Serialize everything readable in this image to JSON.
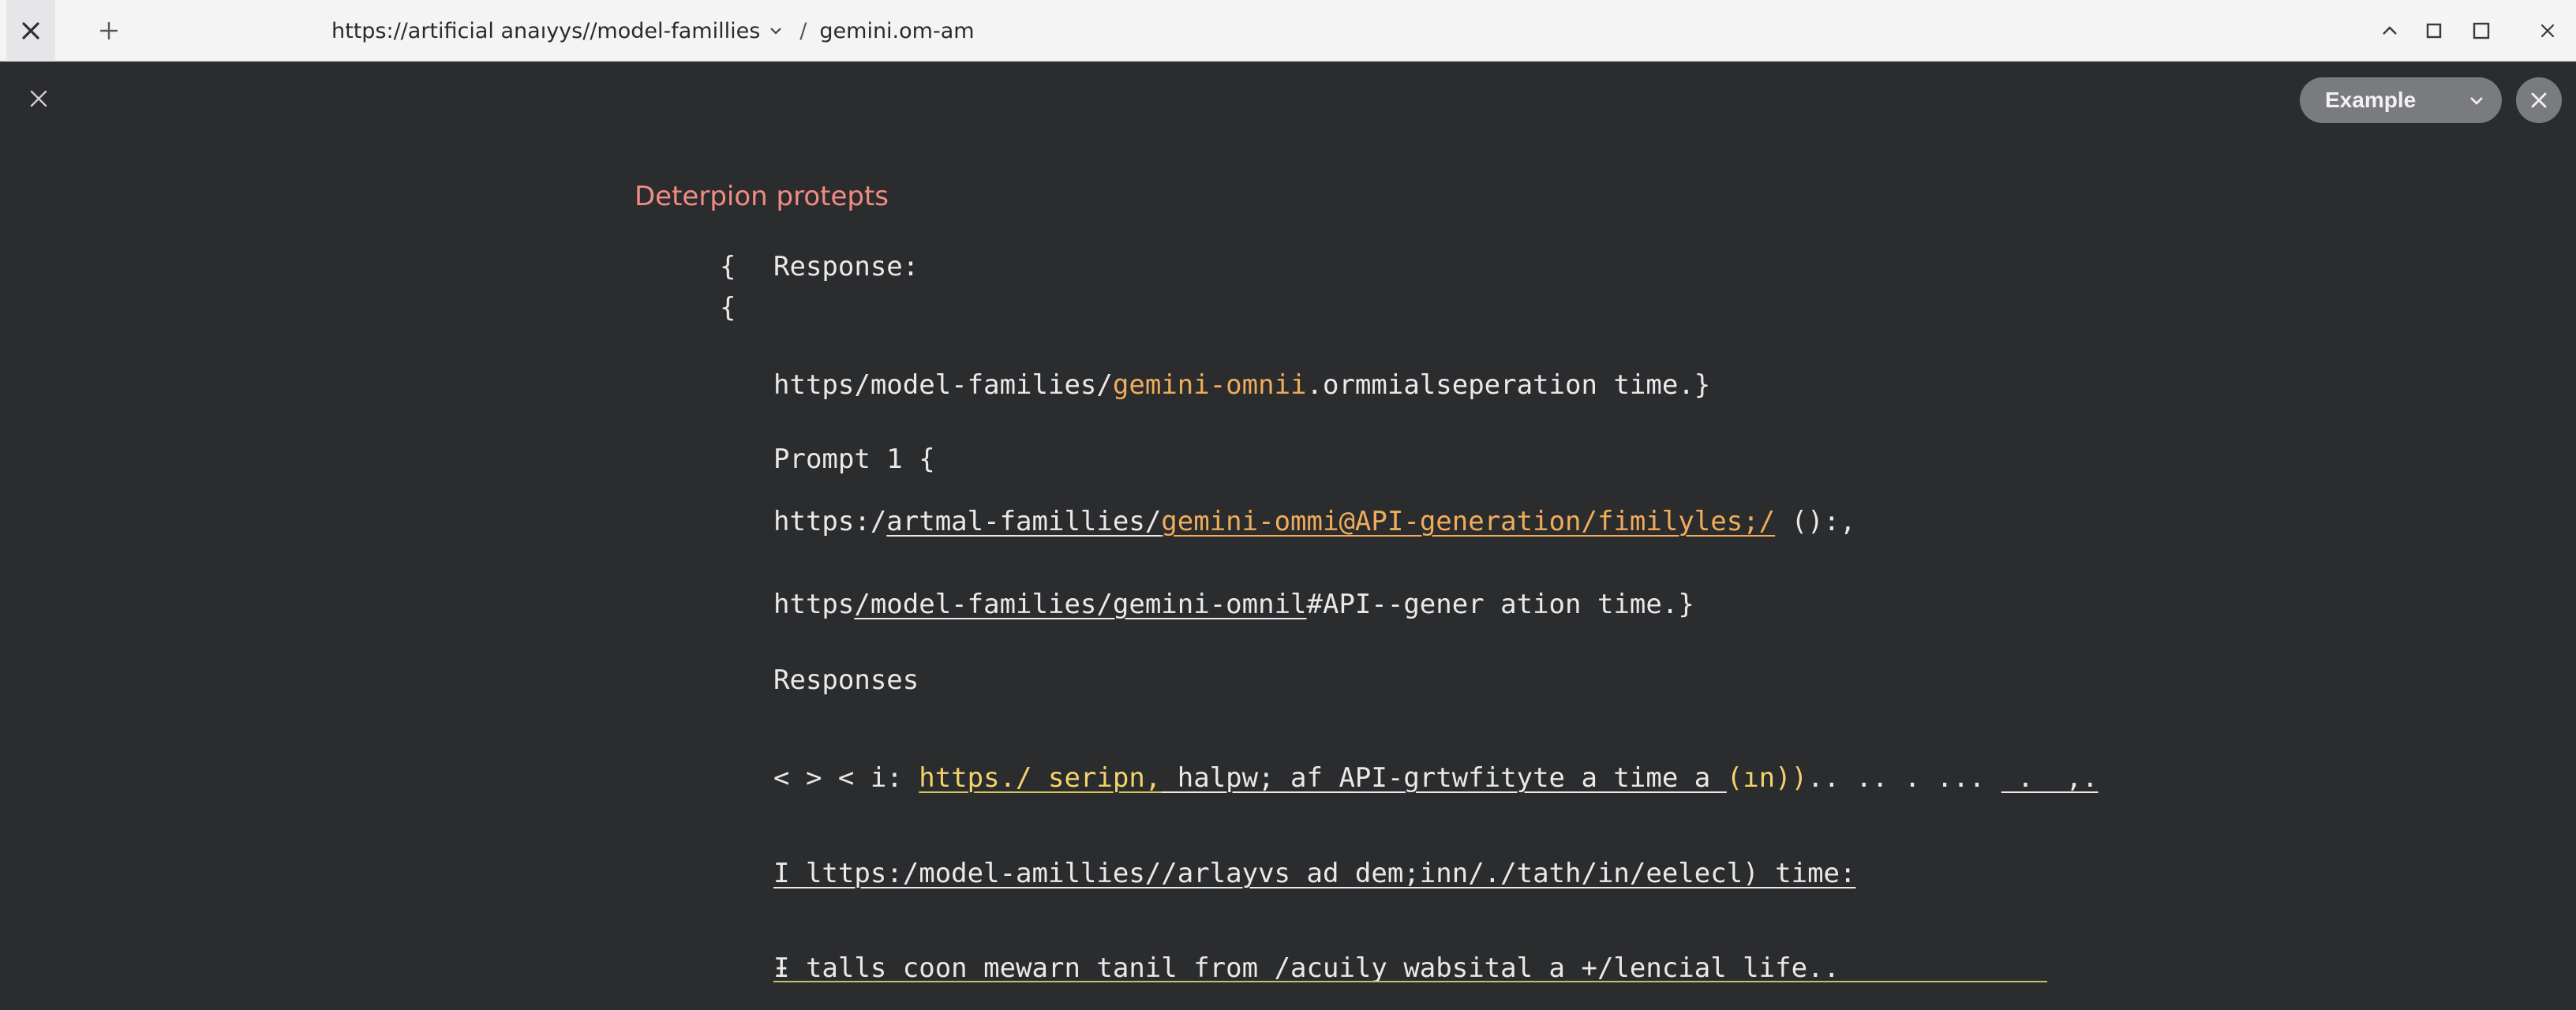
{
  "titlebar": {
    "url": "https://artiﬁcial anaıyys//model-famillies",
    "separator": "/",
    "page": "gemini.om-am"
  },
  "overlay": {
    "example_label": "Example"
  },
  "content": {
    "heading": "Deterpion protepts",
    "brace_1": "{",
    "response_label": "Response:",
    "brace_2": "{",
    "line1": {
      "a": "https/model-families/",
      "b": "gemini-omnii",
      "c": ".ormmialseperation time.}"
    },
    "prompt_label": "Prompt 1 {",
    "line2": {
      "a": "https:/",
      "b": "artmal-famillies/",
      "c": "gemini-ommi@API-generation/fimilyles;/",
      "d": " ():,"
    },
    "line3": {
      "a": "https",
      "b": "/model-families/gemini-omnil",
      "c": "#API--gener ation time.}"
    },
    "responses_label": "Responses",
    "line4": {
      "a": "< > < i: ",
      "b": "https./ seripn,",
      "c": " halpw; af API-grtwfityte a time a ",
      "d": "(ın))",
      "e": ".. .. . ... ",
      "f": " .  ,."
    },
    "line5": "I lttps:/model-amillies//arlayvs ad dem;inn/./tath/in/eelecl) time:",
    "line6": "Ɨ talls coon mewarn tanil from /acuily wabsital a +/lencial life.."
  }
}
